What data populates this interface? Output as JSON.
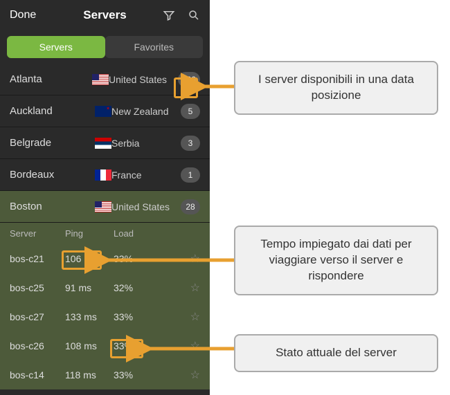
{
  "topbar": {
    "done": "Done",
    "title": "Servers"
  },
  "tabs": {
    "servers": "Servers",
    "favorites": "Favorites"
  },
  "locations": [
    {
      "city": "Atlanta",
      "country": "United States",
      "flag": "us",
      "count": "100"
    },
    {
      "city": "Auckland",
      "country": "New Zealand",
      "flag": "nz",
      "count": "5"
    },
    {
      "city": "Belgrade",
      "country": "Serbia",
      "flag": "rs",
      "count": "3"
    },
    {
      "city": "Bordeaux",
      "country": "France",
      "flag": "fr",
      "count": "1"
    },
    {
      "city": "Boston",
      "country": "United States",
      "flag": "us",
      "count": "28"
    }
  ],
  "server_table": {
    "headers": {
      "name": "Server",
      "ping": "Ping",
      "load": "Load"
    },
    "rows": [
      {
        "name": "bos-c21",
        "ping": "106 ms",
        "load": "33%"
      },
      {
        "name": "bos-c25",
        "ping": "91 ms",
        "load": "32%"
      },
      {
        "name": "bos-c27",
        "ping": "133 ms",
        "load": "33%"
      },
      {
        "name": "bos-c26",
        "ping": "108 ms",
        "load": "33%"
      },
      {
        "name": "bos-c14",
        "ping": "118 ms",
        "load": "33%"
      }
    ]
  },
  "callouts": {
    "c1": "I server disponibili in una data posizione",
    "c2": "Tempo impiegato dai dati per viaggiare verso il server e rispondere",
    "c3": "Stato attuale del server"
  }
}
